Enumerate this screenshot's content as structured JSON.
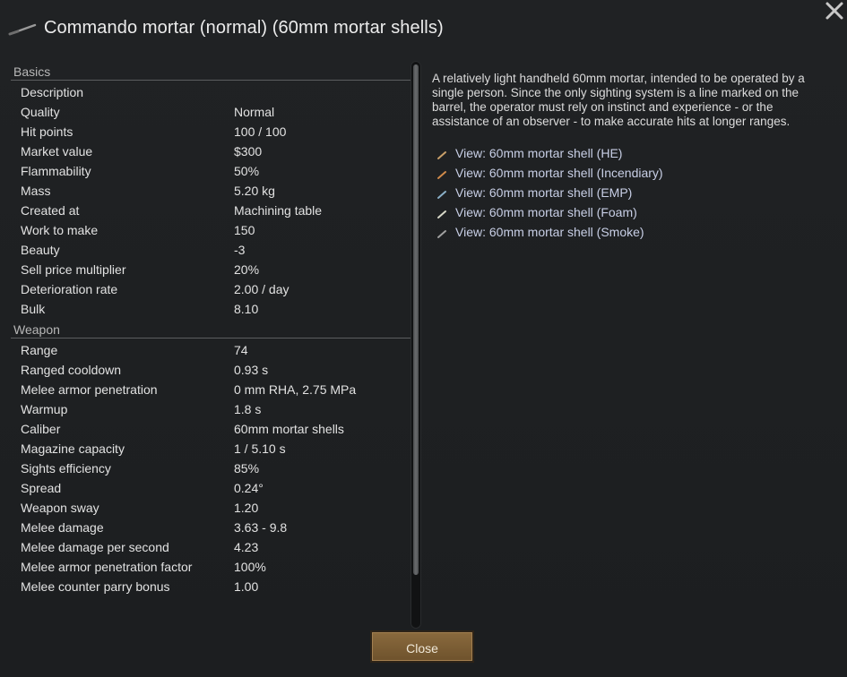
{
  "window": {
    "title": "Commando mortar (normal) (60mm mortar shells)",
    "thing_icon": "mortar-icon",
    "close_icon": "close-icon"
  },
  "sections": [
    {
      "header": "Basics",
      "rows": [
        {
          "label": "Description",
          "value": ""
        },
        {
          "label": "Quality",
          "value": "Normal"
        },
        {
          "label": "Hit points",
          "value": "100 / 100"
        },
        {
          "label": "Market value",
          "value": "$300"
        },
        {
          "label": "Flammability",
          "value": "50%"
        },
        {
          "label": "Mass",
          "value": "5.20 kg"
        },
        {
          "label": "Created at",
          "value": "Machining table"
        },
        {
          "label": "Work to make",
          "value": "150"
        },
        {
          "label": "Beauty",
          "value": "-3"
        },
        {
          "label": "Sell price multiplier",
          "value": "20%"
        },
        {
          "label": "Deterioration rate",
          "value": "2.00 / day"
        },
        {
          "label": "Bulk",
          "value": "8.10"
        }
      ]
    },
    {
      "header": "Weapon",
      "rows": [
        {
          "label": "Range",
          "value": "74"
        },
        {
          "label": "Ranged cooldown",
          "value": "0.93 s"
        },
        {
          "label": "Melee armor penetration",
          "value": "0 mm RHA, 2.75 MPa"
        },
        {
          "label": "Warmup",
          "value": "1.8 s"
        },
        {
          "label": "Caliber",
          "value": "60mm mortar shells"
        },
        {
          "label": "Magazine capacity",
          "value": "1 / 5.10 s"
        },
        {
          "label": "Sights efficiency",
          "value": "85%"
        },
        {
          "label": "Spread",
          "value": "0.24°"
        },
        {
          "label": "Weapon sway",
          "value": "1.20"
        },
        {
          "label": "Melee damage",
          "value": "3.63 - 9.8"
        },
        {
          "label": "Melee damage per second",
          "value": "4.23"
        },
        {
          "label": "Melee armor penetration factor",
          "value": "100%"
        },
        {
          "label": "Melee counter parry bonus",
          "value": "1.00"
        }
      ]
    }
  ],
  "description": "A relatively light handheld 60mm mortar, intended to be operated by a single person. Since the only sighting system is a line marked on the barrel, the operator must rely on instinct and experience - or the assistance of an observer - to make accurate hits at longer ranges.",
  "links": [
    {
      "label": "View: 60mm mortar shell (HE)",
      "icon": "shell-icon",
      "color": "#c9a06a"
    },
    {
      "label": "View: 60mm mortar shell (Incendiary)",
      "icon": "shell-icon",
      "color": "#d08a4a"
    },
    {
      "label": "View: 60mm mortar shell (EMP)",
      "icon": "shell-icon",
      "color": "#8ab0c8"
    },
    {
      "label": "View: 60mm mortar shell (Foam)",
      "icon": "shell-icon",
      "color": "#d8d8c8"
    },
    {
      "label": "View: 60mm mortar shell (Smoke)",
      "icon": "shell-icon",
      "color": "#a0a0a0"
    }
  ],
  "close_button": {
    "label": "Close"
  },
  "colors": {
    "background": "#1b1d1f",
    "link": "#c8cfe6",
    "button": "#7a5c34"
  }
}
